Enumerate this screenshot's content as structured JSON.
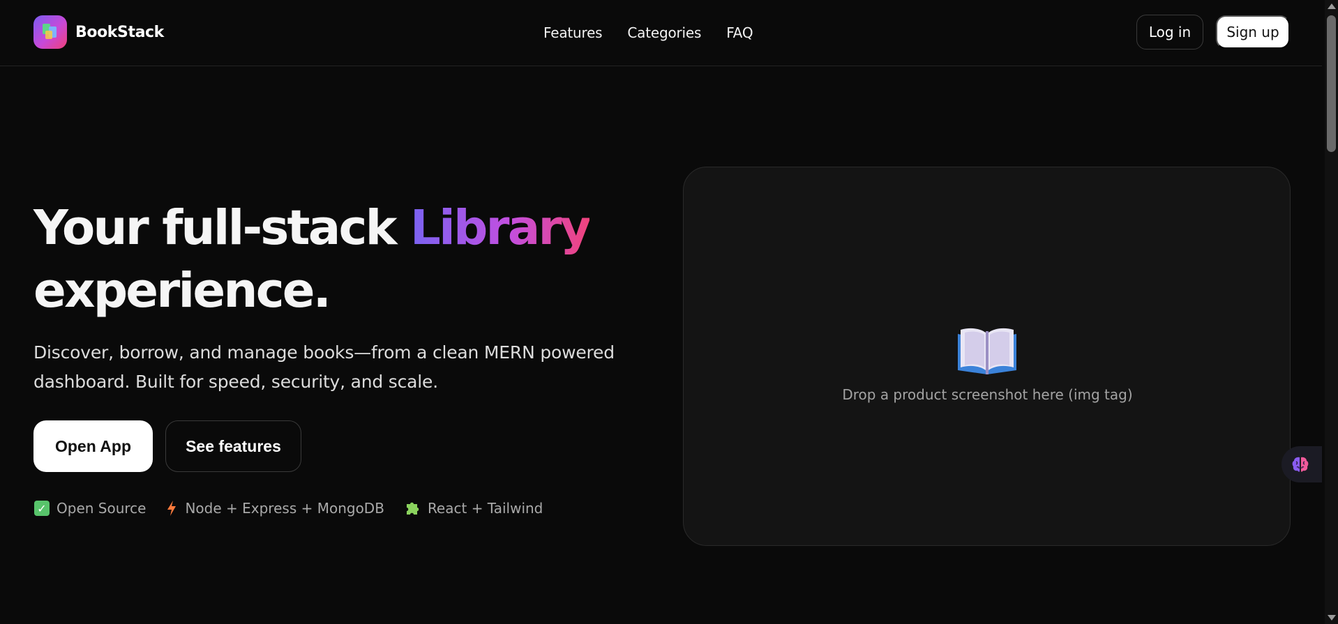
{
  "header": {
    "brand": "BookStack",
    "nav": [
      "Features",
      "Categories",
      "FAQ"
    ],
    "login_label": "Log in",
    "signup_label": "Sign up"
  },
  "hero": {
    "title_main": "Your full-stack ",
    "title_accent": "Library",
    "title_end": "experience.",
    "subtitle": "Discover, borrow, and manage books—from a clean MERN powered dashboard. Built for speed, security, and scale.",
    "primary_cta": "Open App",
    "secondary_cta": "See features",
    "badges": [
      {
        "icon": "check-icon",
        "label": "Open Source"
      },
      {
        "icon": "lightning-icon",
        "label": "Node + Express + MongoDB"
      },
      {
        "icon": "puzzle-icon",
        "label": "React + Tailwind"
      }
    ]
  },
  "preview": {
    "icon": "open-book-icon",
    "caption": "Drop a product screenshot here (img tag)"
  },
  "widget": {
    "icon": "brain-icon"
  },
  "colors": {
    "background": "#0a0a0a",
    "accent_start": "#7a63f2",
    "accent_mid": "#c24fe0",
    "accent_end": "#f0437c"
  }
}
